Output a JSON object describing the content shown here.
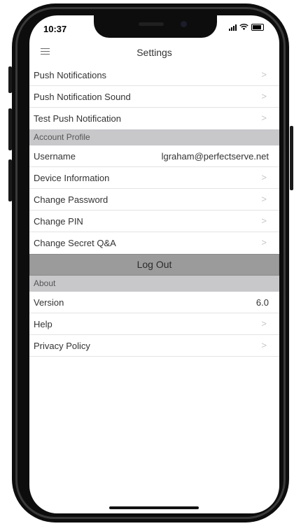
{
  "status_bar": {
    "time": "10:37"
  },
  "header": {
    "title": "Settings"
  },
  "rows_top": [
    {
      "label": "Push Notifications"
    },
    {
      "label": "Push Notification Sound"
    },
    {
      "label": "Test Push Notification"
    }
  ],
  "sections": {
    "account_profile": "Account Profile",
    "about": "About"
  },
  "username": {
    "label": "Username",
    "value": "lgraham@perfectserve.net"
  },
  "rows_account": [
    {
      "label": "Device Information"
    },
    {
      "label": "Change Password"
    },
    {
      "label": "Change PIN"
    },
    {
      "label": "Change Secret Q&A"
    }
  ],
  "logout": {
    "label": "Log Out"
  },
  "version": {
    "label": "Version",
    "value": "6.0"
  },
  "rows_about": [
    {
      "label": "Help"
    },
    {
      "label": "Privacy Policy"
    }
  ],
  "icons": {
    "menu": "hamburger-icon",
    "chevron": "chevron-right-icon",
    "chevron_glyph": ">"
  },
  "colors": {
    "section_bg": "#c8c8cb",
    "logout_bg": "#9b9b9b",
    "text": "#333333"
  }
}
